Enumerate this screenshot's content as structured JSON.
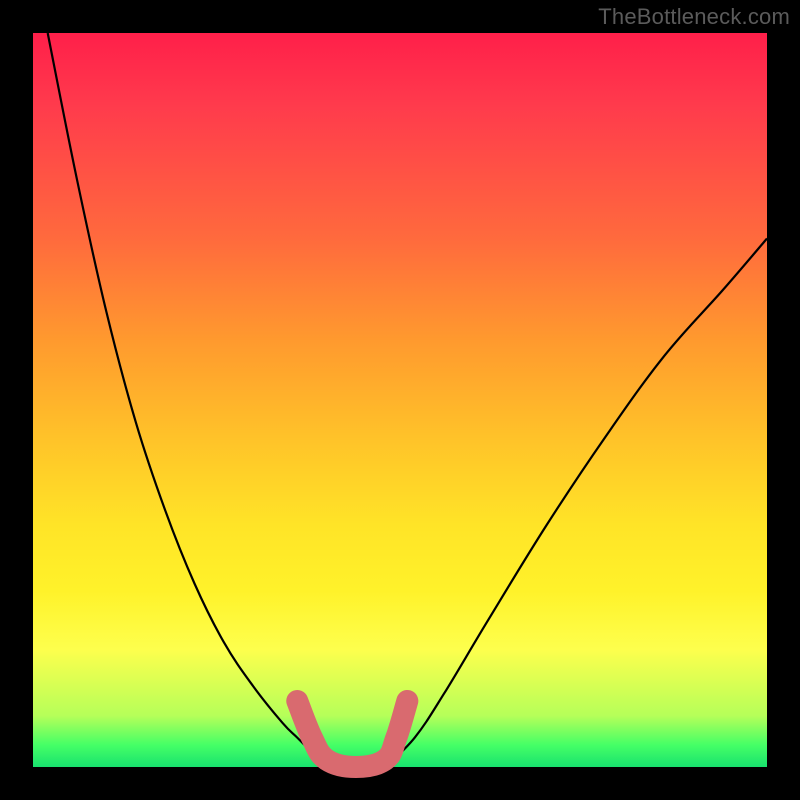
{
  "watermark": "TheBottleneck.com",
  "chart_data": {
    "type": "line",
    "title": "",
    "xlabel": "",
    "ylabel": "",
    "xlim": [
      0,
      100
    ],
    "ylim": [
      0,
      100
    ],
    "grid": false,
    "legend": false,
    "background_gradient": {
      "direction": "vertical",
      "stops": [
        {
          "pos": 0.0,
          "color": "#ff1f4a"
        },
        {
          "pos": 0.28,
          "color": "#ff6a3d"
        },
        {
          "pos": 0.55,
          "color": "#ffc229"
        },
        {
          "pos": 0.76,
          "color": "#fff22a"
        },
        {
          "pos": 0.93,
          "color": "#b6ff59"
        },
        {
          "pos": 1.0,
          "color": "#18e26e"
        }
      ]
    },
    "series": [
      {
        "name": "left-curve",
        "description": "Steep descending curve from top-left down to the valley floor",
        "x": [
          2,
          6,
          10,
          14,
          18,
          22,
          26,
          30,
          34,
          36,
          38,
          40
        ],
        "y": [
          100,
          80,
          62,
          47,
          35,
          25,
          17,
          11,
          6,
          4,
          2,
          0
        ]
      },
      {
        "name": "right-curve",
        "description": "Rising curve from valley floor up toward upper-right",
        "x": [
          48,
          52,
          56,
          62,
          70,
          78,
          86,
          94,
          100
        ],
        "y": [
          0,
          4,
          10,
          20,
          33,
          45,
          56,
          65,
          72
        ]
      },
      {
        "name": "valley-highlight",
        "description": "Thick rounded pink marker tracing the bottom of the V (optimal zone)",
        "color": "#d96a6f",
        "x": [
          36,
          38,
          40,
          44,
          48,
          49.5,
          51
        ],
        "y": [
          9,
          4,
          1,
          0,
          1,
          4,
          9
        ]
      }
    ],
    "annotations": []
  }
}
